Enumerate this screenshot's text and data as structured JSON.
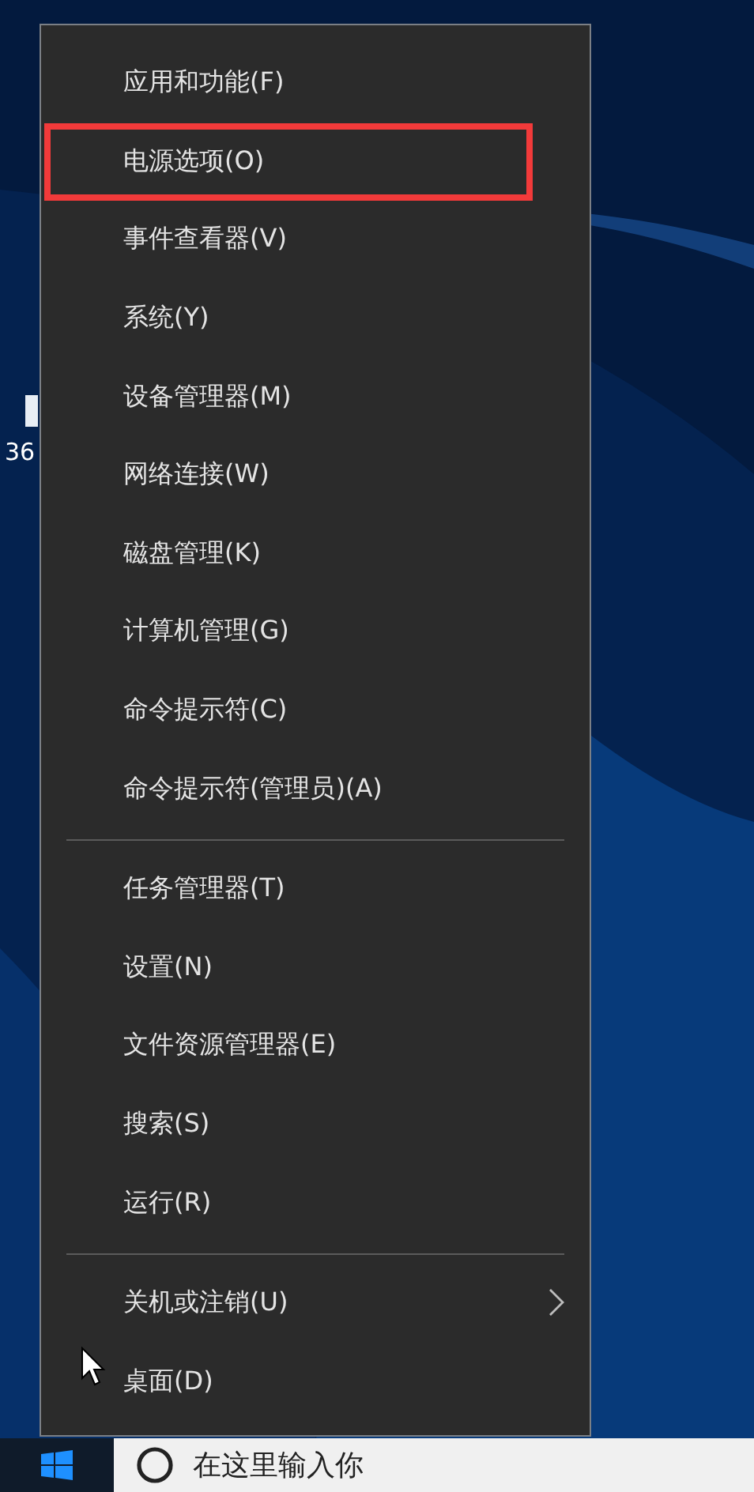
{
  "desktop": {
    "icon_label": "36"
  },
  "menu": {
    "groups": [
      [
        {
          "label": "应用和功能(F)",
          "highlighted": false,
          "submenu": false
        },
        {
          "label": "电源选项(O)",
          "highlighted": true,
          "submenu": false
        },
        {
          "label": "事件查看器(V)",
          "highlighted": false,
          "submenu": false
        },
        {
          "label": "系统(Y)",
          "highlighted": false,
          "submenu": false
        },
        {
          "label": "设备管理器(M)",
          "highlighted": false,
          "submenu": false
        },
        {
          "label": "网络连接(W)",
          "highlighted": false,
          "submenu": false
        },
        {
          "label": "磁盘管理(K)",
          "highlighted": false,
          "submenu": false
        },
        {
          "label": "计算机管理(G)",
          "highlighted": false,
          "submenu": false
        },
        {
          "label": "命令提示符(C)",
          "highlighted": false,
          "submenu": false
        },
        {
          "label": "命令提示符(管理员)(A)",
          "highlighted": false,
          "submenu": false
        }
      ],
      [
        {
          "label": "任务管理器(T)",
          "highlighted": false,
          "submenu": false
        },
        {
          "label": "设置(N)",
          "highlighted": false,
          "submenu": false
        },
        {
          "label": "文件资源管理器(E)",
          "highlighted": false,
          "submenu": false
        },
        {
          "label": "搜索(S)",
          "highlighted": false,
          "submenu": false
        },
        {
          "label": "运行(R)",
          "highlighted": false,
          "submenu": false
        }
      ],
      [
        {
          "label": "关机或注销(U)",
          "highlighted": false,
          "submenu": true
        },
        {
          "label": "桌面(D)",
          "highlighted": false,
          "submenu": false
        }
      ]
    ]
  },
  "taskbar": {
    "search": {
      "placeholder": "在这里输入你"
    }
  }
}
